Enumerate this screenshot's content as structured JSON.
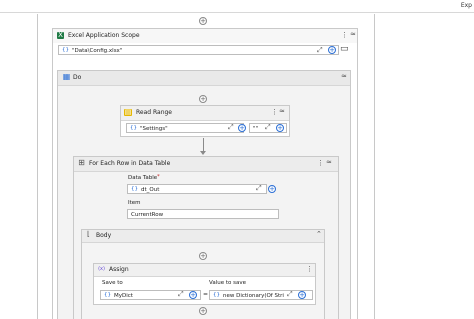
{
  "topbar": {
    "right_text": "Exp"
  },
  "excel_scope": {
    "title": "Excel Application Scope",
    "path_value": "\"Data\\Config.xlsx\""
  },
  "do_sequence": {
    "title": "Do"
  },
  "read_range": {
    "title": "Read Range",
    "sheet_value": "\"Settings\"",
    "range_value": "\"\""
  },
  "for_each": {
    "title": "For Each Row in Data Table",
    "data_table_label": "Data Table",
    "required_marker": "*",
    "data_table_value": "dt_Out",
    "item_label": "Item",
    "item_value": "CurrentRow"
  },
  "body": {
    "title": "Body"
  },
  "assign": {
    "title": "Assign",
    "save_to_label": "Save to",
    "value_label": "Value to save",
    "save_to_value": "MyDict",
    "value_value": "new Dictionary(Of Stri"
  },
  "icons": {
    "expression": "{}",
    "plus": "+",
    "expand": "⤢",
    "kebab": "⋮",
    "collapse": "⌃"
  }
}
